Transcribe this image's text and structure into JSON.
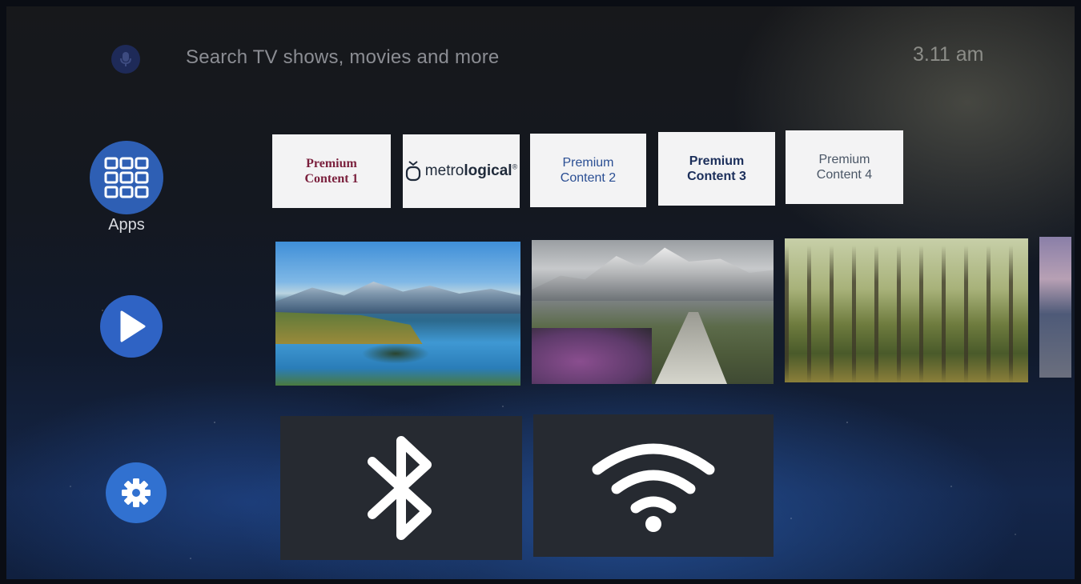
{
  "top_bar": {
    "search_placeholder": "Search TV shows, movies and more",
    "clock": "3.11 am",
    "mic_icon": "microphone-icon"
  },
  "nav": {
    "apps_label": "Apps",
    "items": [
      {
        "id": "apps",
        "icon": "grid-icon"
      },
      {
        "id": "play",
        "icon": "play-icon"
      },
      {
        "id": "settings",
        "icon": "gear-icon"
      }
    ]
  },
  "premium_row": {
    "cards": [
      {
        "label_line1": "Premium",
        "label_line2": "Content 1"
      },
      {
        "logo_text_light": "metro",
        "logo_text_bold": "logical",
        "logo_sup": "®"
      },
      {
        "label_line1": "Premium",
        "label_line2": "Content 2"
      },
      {
        "label_line1": "Premium",
        "label_line2": "Content 3"
      },
      {
        "label_line1": "Premium",
        "label_line2": "Content 4"
      }
    ]
  },
  "image_row": {
    "tiles": [
      {
        "subject": "mountain lake with island"
      },
      {
        "subject": "snowy mountains with stone path"
      },
      {
        "subject": "sunlit forest"
      },
      {
        "subject": "partially visible landscape"
      }
    ]
  },
  "settings_row": {
    "tiles": [
      {
        "icon": "bluetooth-icon"
      },
      {
        "icon": "wifi-icon"
      }
    ]
  },
  "colors": {
    "nav_accent": "#2f63c4",
    "card_bg": "#f3f3f4",
    "settings_tile_bg": "#262a31",
    "content1_text": "#7a1f3c"
  }
}
